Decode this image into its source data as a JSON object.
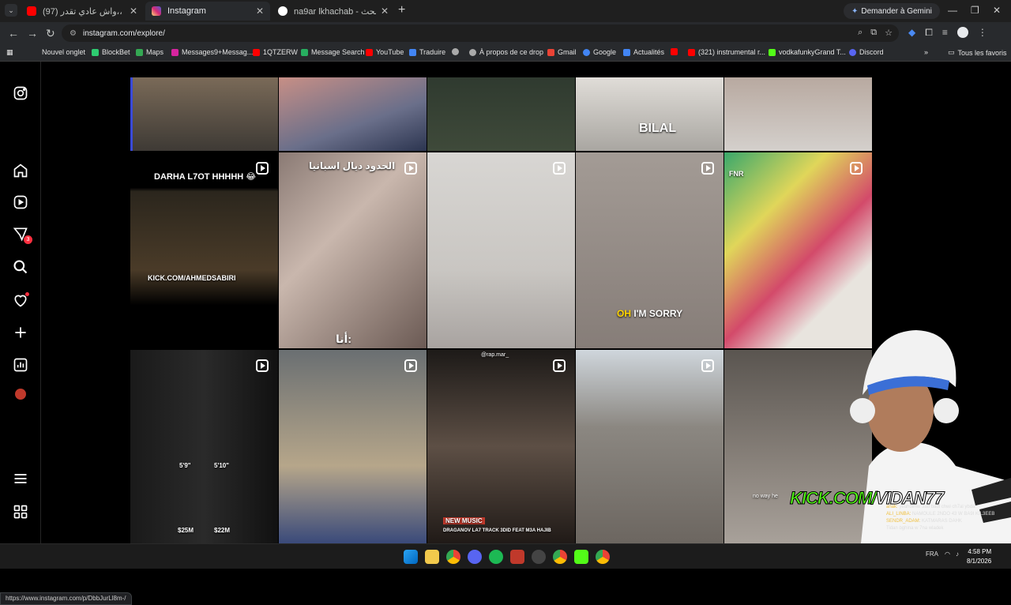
{
  "browser": {
    "tabs": [
      {
        "label": "(97) تحدي البقاء ،،واش عادي تقدر..",
        "fav_color": "#ff0000"
      },
      {
        "label": "Instagram",
        "fav_color": "#d6249f",
        "active": true
      },
      {
        "label": "na9ar lkhachab - بحث Google",
        "fav_color": "#4285f4"
      }
    ],
    "new_tab": "+",
    "gemini_label": "Demander à Gemini",
    "url": "instagram.com/explore/",
    "bookmarks": [
      {
        "label": "Nouvel onglet",
        "color": "#888888"
      },
      {
        "label": "BlockBet",
        "color": "#2ecc71"
      },
      {
        "label": "Maps",
        "color": "#34a853"
      },
      {
        "label": "Messages9+Messag...",
        "color": "#d6249f"
      },
      {
        "label": "1QTZERW",
        "color": "#ff0000"
      },
      {
        "label": "Message Search",
        "color": "#27ae60"
      },
      {
        "label": "YouTube",
        "color": "#ff0000"
      },
      {
        "label": "Traduire",
        "color": "#4285f4"
      },
      {
        "label": "",
        "color": "#aaaaaa"
      },
      {
        "label": "À propos de ce drop",
        "color": "#aaaaaa"
      },
      {
        "label": "Gmail",
        "color": "#ea4335"
      },
      {
        "label": "Google",
        "color": "#4285f4"
      },
      {
        "label": "Actualités",
        "color": "#4285f4"
      },
      {
        "label": "",
        "color": "#ff0000"
      },
      {
        "label": "(321) instrumental r...",
        "color": "#ff0000"
      },
      {
        "label": "vodkafunkyGrand T...",
        "color": "#53fc18"
      },
      {
        "label": "Discord",
        "color": "#5865f2"
      }
    ],
    "all_bookmarks": "Tous les favoris",
    "status_url": "https://www.instagram.com/p/DbbJurLl8m-/"
  },
  "sidebar": {
    "icons": [
      "instagram-logo-icon",
      "home-icon",
      "reels-icon",
      "messages-icon",
      "search-icon",
      "notifications-icon",
      "create-icon",
      "dashboard-icon",
      "profile-avatar",
      "menu-icon",
      "more-apps-icon"
    ],
    "messages_badge": "3"
  },
  "tiles": {
    "r0c3_caption": "BILAL",
    "r1c0_caption": "DARHA L7OT HHHHH 😂",
    "r1c0_kick": "KICK.COM/AHMEDSABIRI",
    "r1c1_caption": "الحدود ديال اسبانيا",
    "r1c1_bottom": "أنا:",
    "r1c3_caption_a": "OH",
    "r1c3_caption_b": "I'M SORRY",
    "r1c4_brand": "FNR",
    "r2c0_left_height": "5'9\"",
    "r2c0_right_height": "5'10\"",
    "r2c0_left_worth": "$25M",
    "r2c0_right_worth": "$22M",
    "r2c2_handle": "@rap.mar_",
    "r2c2_tag": "NEW MUSIC",
    "r2c2_title": "DRAGANOV LA7 TRACK 3DID FEAT M3A HAJIB",
    "r2c4_caption": "no way he"
  },
  "stream": {
    "kick_prefix": "KICK.COM/",
    "kick_name": "VIDAN77",
    "chat": [
      {
        "user": "anak:",
        "msg": "yeahdimw 3ad badi chwi ch7al ybda"
      },
      {
        "user": "ALI_LINBA:",
        "msg": "NAMOULE 2NDO 43 W BA9I KIL3EEB"
      },
      {
        "user": "SENDR_ADAM:",
        "msg": "KATMARAS DAHK"
      },
      {
        "user": "",
        "msg": "Tidan bghina w 7na wladek"
      }
    ]
  },
  "taskbar": {
    "lang": "FRA",
    "time": "4:58 PM",
    "date": "8/1/2026"
  },
  "colors": {
    "ig_red": "#ff3040",
    "kick_green": "#53fc18",
    "chrome_bg": "#282a2d"
  }
}
